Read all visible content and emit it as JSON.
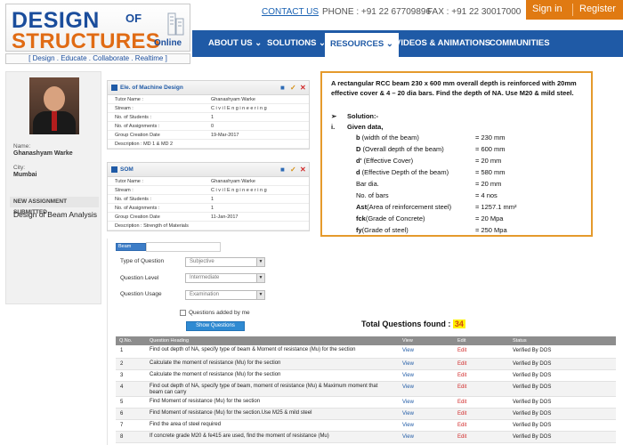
{
  "logo": {
    "line1": "DESIGN",
    "of": "OF",
    "line2": "STRUCTURES",
    "online": "Online",
    "tagline": "[ Design . Educate . Collaborate . Realtime ]"
  },
  "topbar": {
    "contact": "CONTACT US",
    "phone": "PHONE : +91 22 67709896",
    "fax": "FAX : +91 22 30017000",
    "signin": "Sign in",
    "register": "Register"
  },
  "nav": {
    "items": [
      "ABOUT US ⌄",
      "SOLUTIONS ⌄",
      "RESOURCES ⌄",
      "VIDEOS & ANIMATIONS",
      "COMMUNITIES"
    ]
  },
  "profile": {
    "name_label": "Name:",
    "name": "Ghanashyam Warke",
    "city_label": "City:",
    "city": "Mumbai",
    "new_assignment_heading": "NEW ASSIGNMENT SUBMITTED",
    "new_assignment_title": "Design of Beam Analysis"
  },
  "groups": [
    {
      "title": "Ele. of Machine Design",
      "rows": [
        [
          "Tutor Name :",
          "Ghanashyam  Warke"
        ],
        [
          "Stream :",
          "C i v i l  E n g i n e e r i n g"
        ],
        [
          "No. of Students :",
          "1"
        ],
        [
          "No. of Assignments :",
          "0"
        ],
        [
          "Group Creation Date",
          "19-Mar-2017"
        ]
      ],
      "description": "Description : MD 1 & MD 2"
    },
    {
      "title": "SOM",
      "rows": [
        [
          "Tutor Name :",
          "Ghanashyam  Warke"
        ],
        [
          "Stream :",
          "C i v i l  E n g i n e e r i n g"
        ],
        [
          "No. of Students :",
          "1"
        ],
        [
          "No. of Assignments :",
          "1"
        ],
        [
          "Group Creation Date",
          "11-Jan-2017"
        ]
      ],
      "description": "Description : Strength of Materials"
    }
  ],
  "question": {
    "text": "A rectangular RCC beam 230 x 600 mm overall depth is reinforced with 20mm effective cover & 4 – 20 dia bars. Find the depth of NA. Use M20 & mild steel.",
    "solution_marker": "➢",
    "solution_label": "Solution:-",
    "given_marker": "i.",
    "given_label": "Given data,",
    "data": [
      {
        "sym": "b",
        "desc": " (width of the beam)",
        "val": "= 230 mm"
      },
      {
        "sym": "D",
        "desc": " (Overall depth of the beam)",
        "val": "= 600 mm"
      },
      {
        "sym": "d'",
        "desc": " (Effective Cover)",
        "val": "= 20 mm"
      },
      {
        "sym": "d",
        "desc": " (Effective Depth of the beam)",
        "val": "= 580 mm"
      },
      {
        "sym": "",
        "desc": "Bar dia.",
        "val": "= 20 mm"
      },
      {
        "sym": "",
        "desc": "No. of bars",
        "val": "= 4 nos"
      },
      {
        "sym": "Ast",
        "desc": "(Area of reinforcement steel)",
        "val": "= 1257.1 mm²"
      },
      {
        "sym": "fck",
        "desc": "(Grade of Concrete)",
        "val": "= 20 Mpa"
      },
      {
        "sym": "fy",
        "desc": "(Grade of steel)",
        "val": "= 250 Mpa"
      }
    ]
  },
  "filters": {
    "search_tag": "Beam",
    "type_label": "Type of Question",
    "type_value": "Subjective",
    "level_label": "Question Level",
    "level_value": "Intermediate",
    "usage_label": "Question Usage",
    "usage_value": "Examination",
    "checkbox_label": "Questions added by me",
    "show_button": "Show Questions",
    "total_label": "Total Questions found :",
    "total_count": "34"
  },
  "table": {
    "headers": [
      "Q.No.",
      "Question Heading",
      "View",
      "Edit",
      "Status"
    ],
    "rows": [
      {
        "no": "1",
        "heading": "Find out depth of NA, specify type of beam & Moment of resistance (Mu) for the section",
        "view": "View",
        "edit": "Edit",
        "status": "Verified By DOS"
      },
      {
        "no": "2",
        "heading": "Calculate the moment of resistance (Mu) for the section",
        "view": "View",
        "edit": "Edit",
        "status": "Verified By DOS"
      },
      {
        "no": "3",
        "heading": "Calculate the moment of resistance (Mu) for the section",
        "view": "View",
        "edit": "Edit",
        "status": "Verified By DOS"
      },
      {
        "no": "4",
        "heading": "Find out depth of NA, specify type of beam, moment of resistance (Mu) & Maximum moment that beam can carry",
        "view": "View",
        "edit": "Edit",
        "status": "Verified By DOS"
      },
      {
        "no": "5",
        "heading": "Find Moment of resistance (Mu) for the section",
        "view": "View",
        "edit": "Edit",
        "status": "Verified By DOS"
      },
      {
        "no": "6",
        "heading": "Find Moment of resistance (Mu) for the section.Use M25 & mild steel",
        "view": "View",
        "edit": "Edit",
        "status": "Verified By DOS"
      },
      {
        "no": "7",
        "heading": "Find the area of steel required",
        "view": "View",
        "edit": "Edit",
        "status": "Verified By DOS"
      },
      {
        "no": "8",
        "heading": "If concrete grade M20 & fe415 are used, find the moment of resistance (Mu)",
        "view": "View",
        "edit": "Edit",
        "status": "Verified By DOS"
      }
    ]
  }
}
